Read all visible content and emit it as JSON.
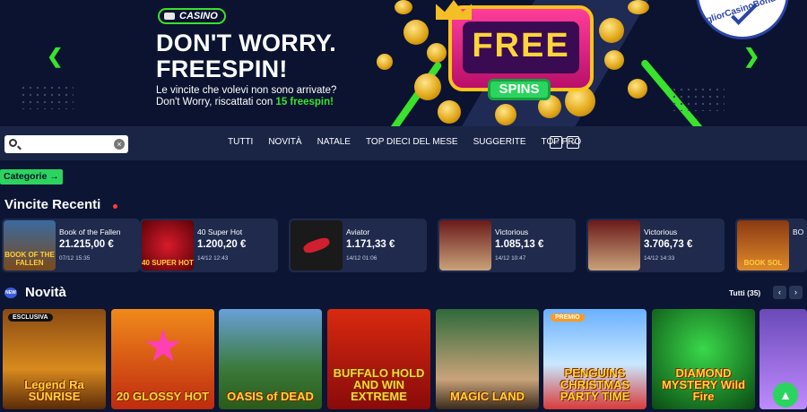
{
  "hero": {
    "badge": "CASINO",
    "title_line1": "DON'T WORRY.",
    "title_line2": "FREESPIN!",
    "sub_line1": "Le vincite che volevi non sono arrivate?",
    "sub_line2_prefix": "Don't Worry, riscattati con ",
    "sub_line2_highlight": "15 freespin!",
    "slot_text": "FREE",
    "spins_text": "SPINS",
    "prev_icon": "chevron-left-icon",
    "next_icon": "chevron-right-icon",
    "seal_text": "igliorCasinoBonus.co",
    "accent": "#39e22c"
  },
  "search": {
    "placeholder": "",
    "value": ""
  },
  "nav": {
    "tabs": [
      "TUTTI",
      "NOVITÀ",
      "NATALE",
      "TOP DIECI DEL MESE",
      "SUGGERITE",
      "TOP PRO"
    ]
  },
  "categories_button": "Categorie →",
  "recent": {
    "title": "Vincite Recenti",
    "wins": [
      {
        "game": "Book of the Fallen",
        "amount": "21.215,00 €",
        "time": "07/12 15:35",
        "thumb_label": "BOOK OF THE FALLEN"
      },
      {
        "game": "40 Super Hot",
        "amount": "1.200,20 €",
        "time": "14/12 12:43",
        "thumb_label": "40 SUPER HOT"
      },
      {
        "game": "Aviator",
        "amount": "1.171,33 €",
        "time": "14/12 01:06",
        "thumb_label": ""
      },
      {
        "game": "Victorious",
        "amount": "1.085,13 €",
        "time": "14/12 10:47",
        "thumb_label": ""
      },
      {
        "game": "Victorious",
        "amount": "3.706,73 €",
        "time": "14/12 14:33",
        "thumb_label": ""
      },
      {
        "game": "BO",
        "amount": "",
        "time": "",
        "thumb_label": "BOOK SOL"
      }
    ]
  },
  "novita": {
    "badge": "NEW",
    "title": "Novità",
    "tutti_label": "Tutti (35)",
    "games": [
      {
        "label": "Legend Ra SUNRISE",
        "tag": "ESCLUSIVA"
      },
      {
        "label": "20 GLOSSY HOT",
        "tag": ""
      },
      {
        "label": "OASIS of DEAD",
        "tag": ""
      },
      {
        "label": "BUFFALO HOLD AND WIN EXTREME",
        "tag": ""
      },
      {
        "label": "MAGIC LAND",
        "tag": ""
      },
      {
        "label": "PENGUINS CHRISTMAS PARTY TIME",
        "tag": "PREMIO"
      },
      {
        "label": "DIAMOND MYSTERY Wild Fire",
        "tag": ""
      },
      {
        "label": "",
        "tag": ""
      }
    ]
  }
}
